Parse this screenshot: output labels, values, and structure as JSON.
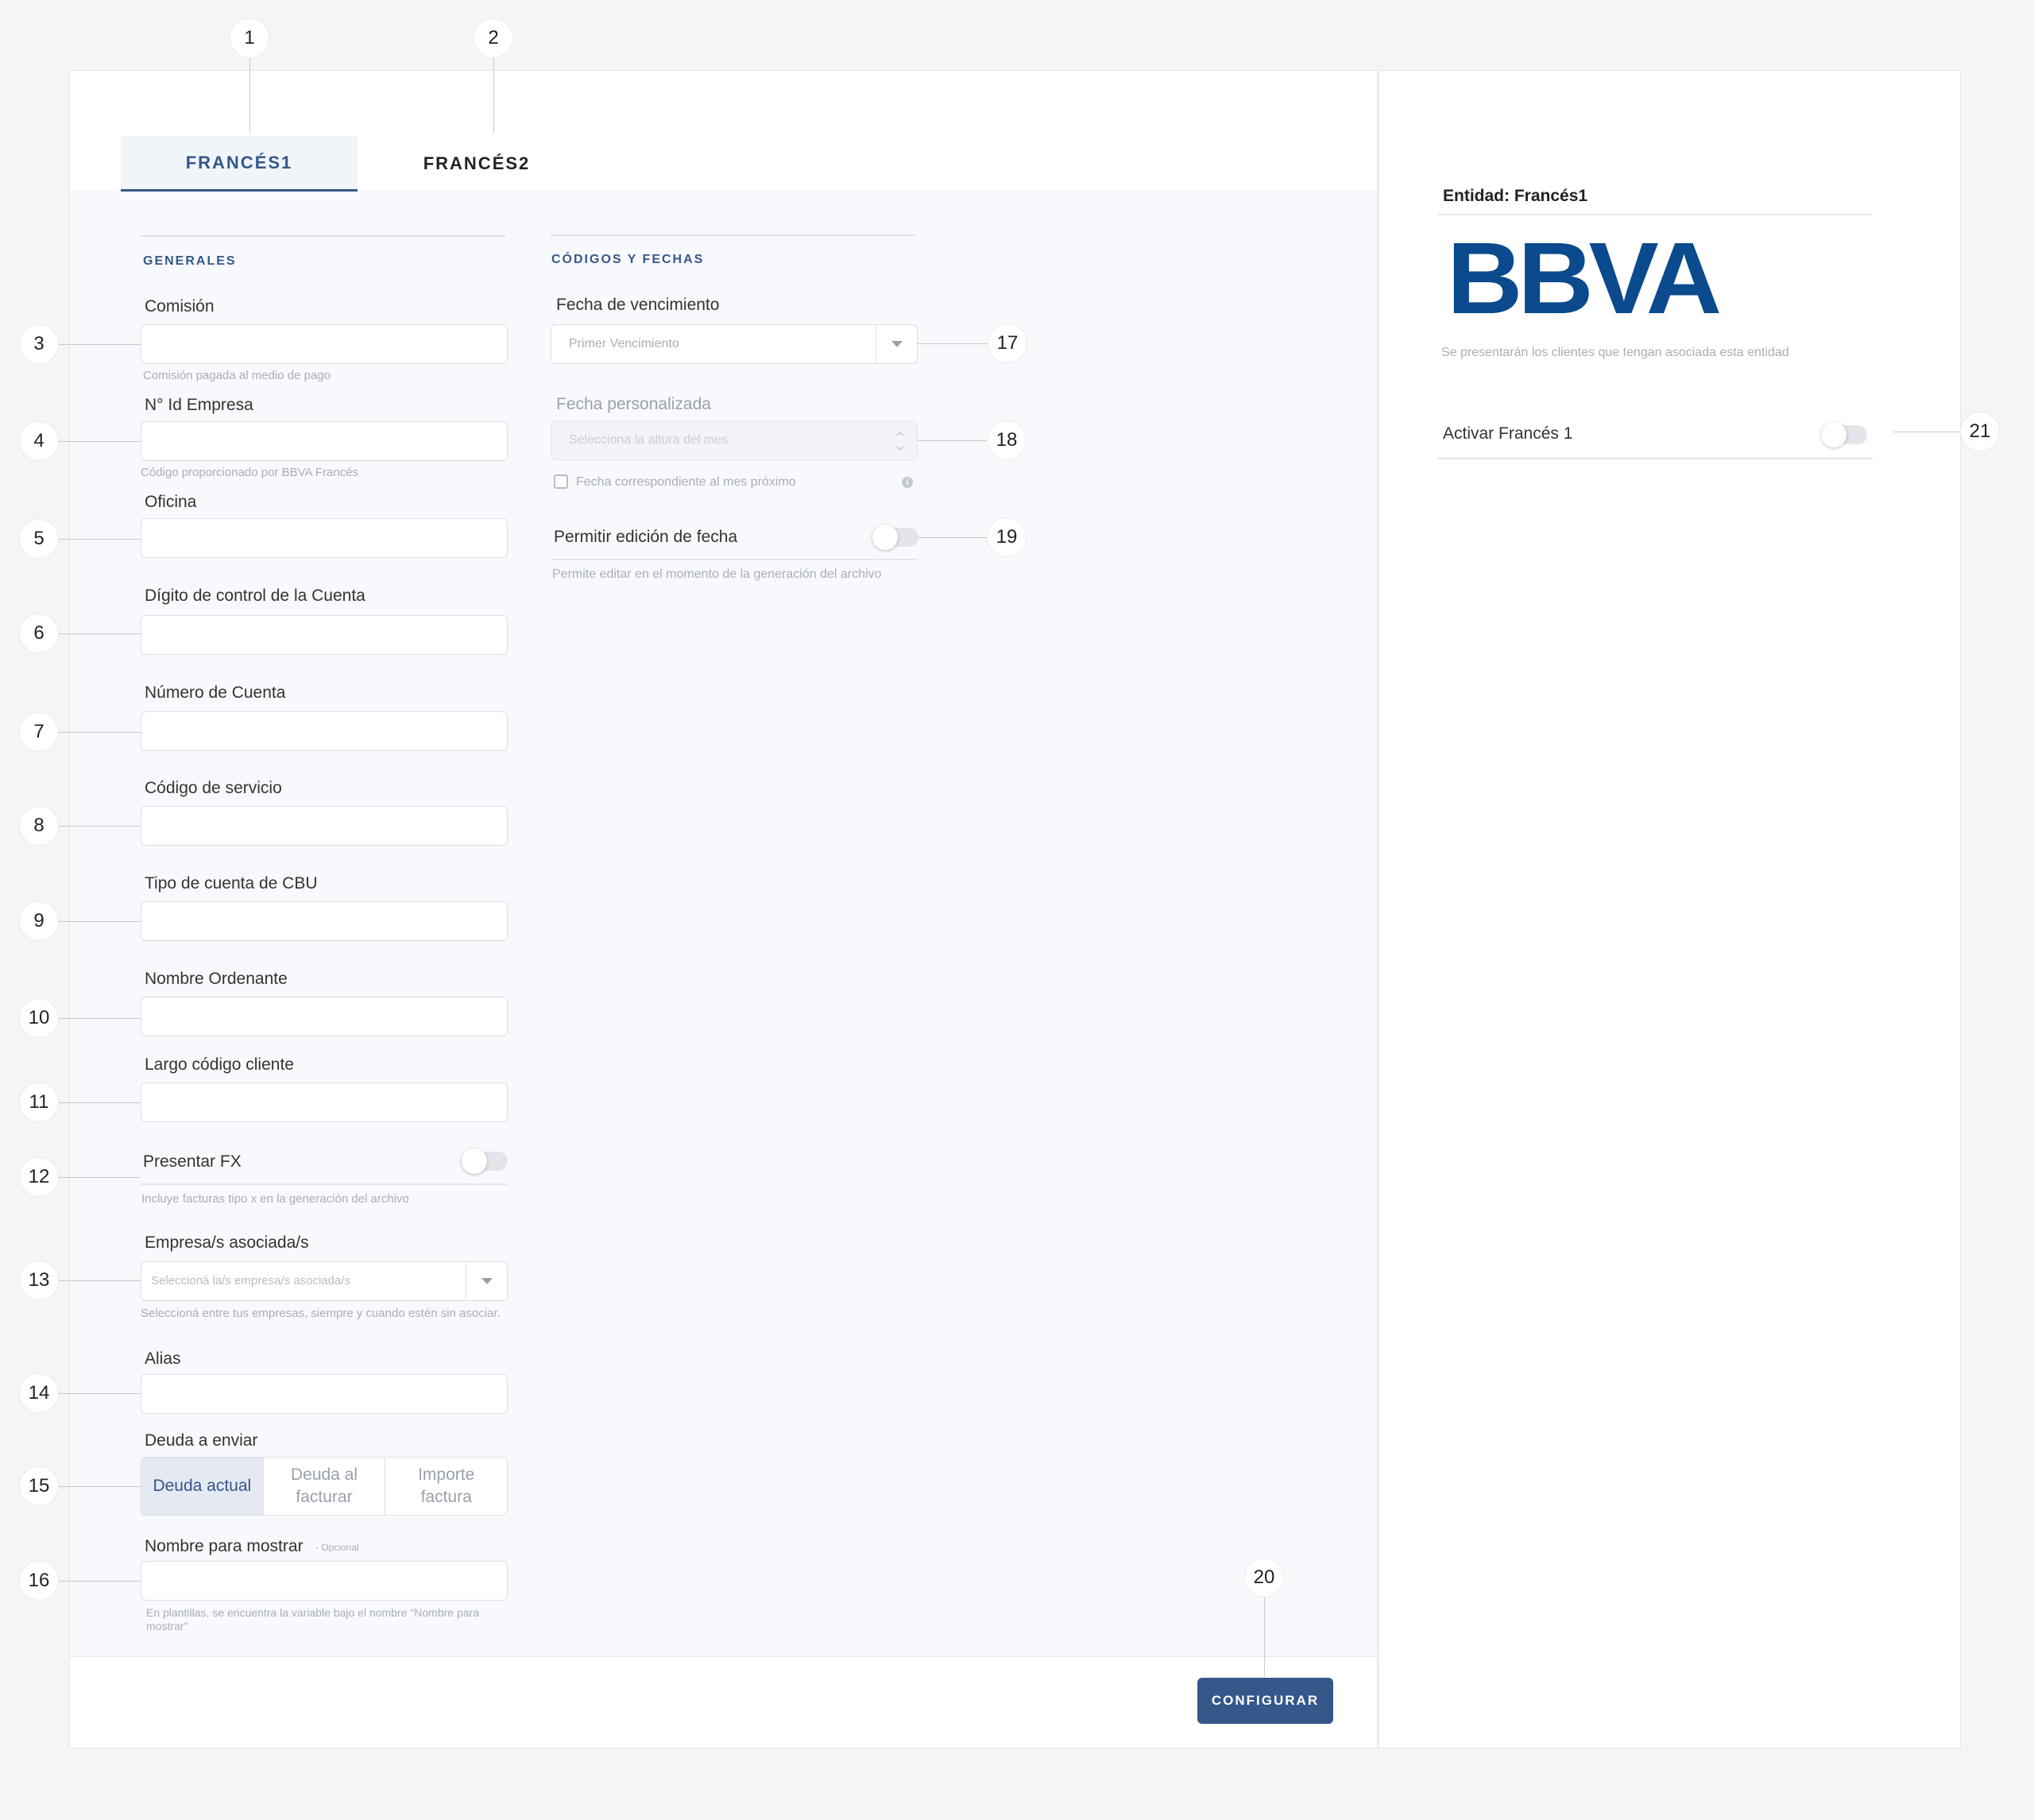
{
  "tabs": [
    {
      "label": "FRANCÉS1",
      "active": true
    },
    {
      "label": "FRANCÉS2",
      "active": false
    }
  ],
  "generales": {
    "title": "GENERALES",
    "comision": {
      "label": "Comisión",
      "hint": "Comisión pagada al medio de pago",
      "value": ""
    },
    "id_empresa": {
      "label": "N° Id Empresa",
      "hint": "Código proporcionado por BBVA Francés",
      "value": ""
    },
    "oficina": {
      "label": "Oficina",
      "value": ""
    },
    "digito_control": {
      "label": "Dígito de control de la Cuenta",
      "value": ""
    },
    "numero_cuenta": {
      "label": "Número de Cuenta",
      "value": ""
    },
    "codigo_servicio": {
      "label": "Código de servicio",
      "value": ""
    },
    "tipo_cuenta_cbu": {
      "label": "Tipo de cuenta de CBU",
      "value": ""
    },
    "nombre_ordenante": {
      "label": "Nombre Ordenante",
      "value": ""
    },
    "largo_codigo_cliente": {
      "label": "Largo código cliente",
      "value": ""
    },
    "presentar_fx": {
      "label": "Presentar FX",
      "hint": "Incluye facturas tipo x en la generación del archivo",
      "on": false
    },
    "empresas_asociadas": {
      "label": "Empresa/s asociada/s",
      "placeholder": "Seleccioná la/s empresa/s asociada/s",
      "hint": "Seleccioná entre tus empresas, siempre y cuando estén sin asociar."
    },
    "alias": {
      "label": "Alias",
      "value": ""
    },
    "deuda_enviar": {
      "label": "Deuda a enviar",
      "options": [
        "Deuda actual",
        "Deuda al facturar",
        "Importe factura"
      ],
      "selected": "Deuda actual"
    },
    "nombre_mostrar": {
      "label": "Nombre para mostrar",
      "optional": "- Opcional",
      "hint": "En plantillas, se encuentra la variable bajo el nombre \"Nombre para mostrar\"",
      "value": ""
    }
  },
  "codigos": {
    "title": "CÓDIGOS Y FECHAS",
    "fecha_vencimiento": {
      "label": "Fecha de vencimiento",
      "selected": "Primer Vencimiento"
    },
    "fecha_personalizada": {
      "label": "Fecha personalizada",
      "placeholder": "Selecciona la altura del mes"
    },
    "mes_proximo": {
      "label": "Fecha correspondiente al mes próximo",
      "checked": false
    },
    "permitir_edicion": {
      "label": "Permitir edición de fecha",
      "hint": "Permite editar en el momento de la generación del archivo",
      "on": false
    }
  },
  "footer": {
    "configure_label": "CONFIGURAR"
  },
  "entity": {
    "title": "Entidad: Francés1",
    "logo_text": "BBVA",
    "description": "Se presentarán los clientes que tengan asociada esta entidad",
    "activate_label": "Activar Francés 1",
    "activate_on": false
  },
  "callouts": [
    "1",
    "2",
    "3",
    "4",
    "5",
    "6",
    "7",
    "8",
    "9",
    "10",
    "11",
    "12",
    "13",
    "14",
    "15",
    "16",
    "17",
    "18",
    "19",
    "20",
    "21"
  ],
  "colors": {
    "accent": "#35578a",
    "logo": "#0b4a8c",
    "background": "#f5f5f6"
  },
  "icons": {
    "select_arrow": "chevron-down-icon",
    "stepper": "stepper-icon",
    "info": "info-icon"
  }
}
